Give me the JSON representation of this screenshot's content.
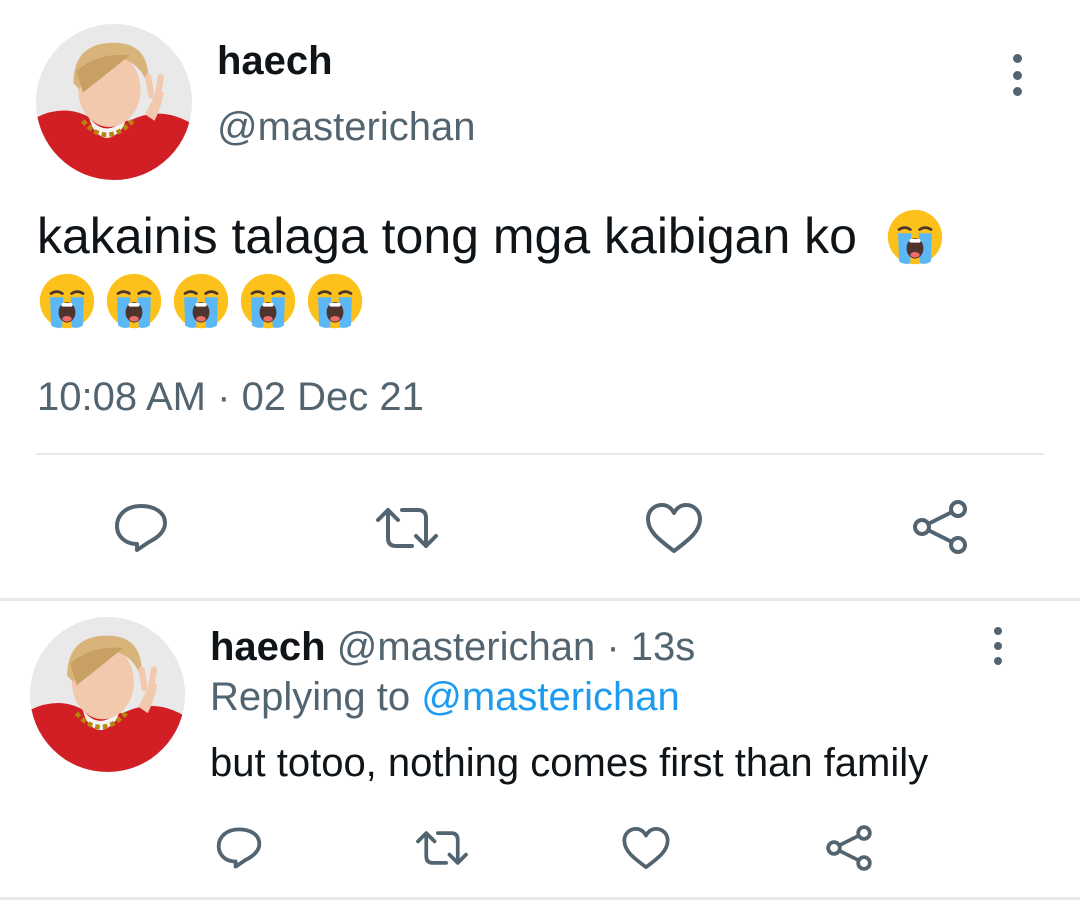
{
  "main_tweet": {
    "display_name": "haech",
    "handle": "@masterichan",
    "text": "kakainis talaga tong mga kaibigan ko",
    "emojis": [
      "loudly-crying-face",
      "loudly-crying-face",
      "loudly-crying-face",
      "loudly-crying-face",
      "loudly-crying-face",
      "loudly-crying-face"
    ],
    "time": "10:08 AM",
    "separator": " · ",
    "date": "02 Dec 21"
  },
  "reply_tweet": {
    "display_name": "haech",
    "handle": "@masterichan",
    "separator": " · ",
    "age": "13s",
    "replying_prefix": "Replying to ",
    "replying_to": "@masterichan",
    "text": "but totoo, nothing comes first than family"
  },
  "icons": {
    "actions": [
      "reply-icon",
      "retweet-icon",
      "like-icon",
      "share-icon"
    ],
    "more": "more-options-icon"
  },
  "colors": {
    "primary_text": "#0f1419",
    "secondary_text": "#536471",
    "link": "#1d9bf0",
    "divider": "#e7e9ea"
  }
}
